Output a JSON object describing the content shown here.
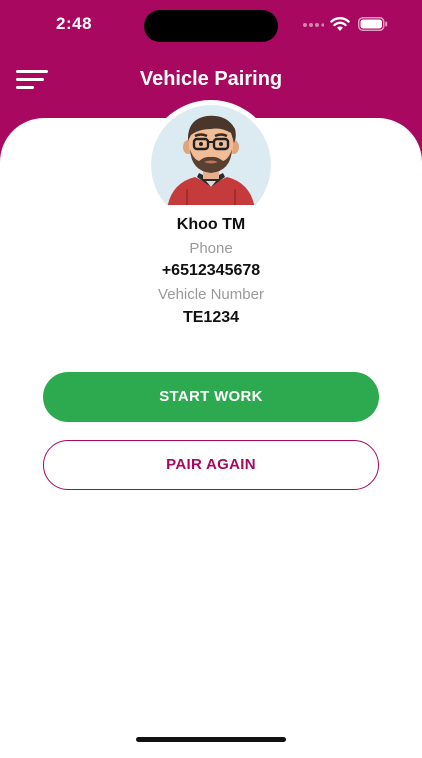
{
  "status_bar": {
    "time": "2:48"
  },
  "header": {
    "title": "Vehicle Pairing",
    "menu_icon": "hamburger-menu-icon",
    "background_color": "#a8085f"
  },
  "profile": {
    "name": "Khoo TM",
    "phone_label": "Phone",
    "phone": "+6512345678",
    "vehicle_label": "Vehicle Number",
    "vehicle_number": "TE1234",
    "avatar_icon": "user-avatar"
  },
  "actions": {
    "start_work_label": "START WORK",
    "start_work_color": "#2daa4f",
    "pair_again_label": "PAIR AGAIN",
    "pair_again_color": "#a8085f"
  }
}
